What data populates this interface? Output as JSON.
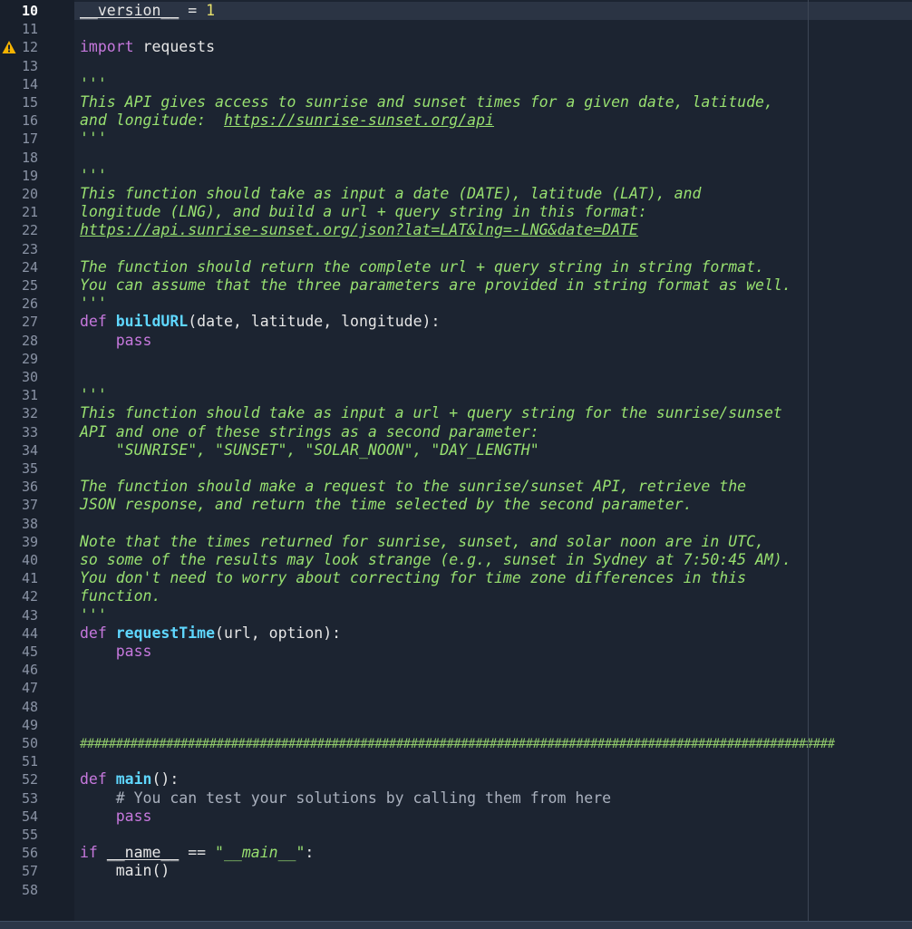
{
  "editor": {
    "current_line": "10",
    "warning_line": "12",
    "lines": [
      {
        "n": "10",
        "segs": [
          {
            "t": "__version__",
            "c": "dunder"
          },
          {
            "t": " = ",
            "c": ""
          },
          {
            "t": "1",
            "c": "num"
          }
        ]
      },
      {
        "n": "11",
        "segs": []
      },
      {
        "n": "12",
        "segs": [
          {
            "t": "import",
            "c": "kw"
          },
          {
            "t": " requests",
            "c": ""
          }
        ]
      },
      {
        "n": "13",
        "segs": []
      },
      {
        "n": "14",
        "segs": [
          {
            "t": "'''",
            "c": "doc"
          }
        ]
      },
      {
        "n": "15",
        "segs": [
          {
            "t": "This API gives access to sunrise and sunset times for a given date, latitude,",
            "c": "doc"
          }
        ]
      },
      {
        "n": "16",
        "segs": [
          {
            "t": "and longitude:  ",
            "c": "doc"
          },
          {
            "t": "https://sunrise-sunset.org/api",
            "c": "doc link"
          }
        ]
      },
      {
        "n": "17",
        "segs": [
          {
            "t": "'''",
            "c": "doc"
          }
        ]
      },
      {
        "n": "18",
        "segs": []
      },
      {
        "n": "19",
        "segs": [
          {
            "t": "'''",
            "c": "doc"
          }
        ]
      },
      {
        "n": "20",
        "segs": [
          {
            "t": "This function should take as input a date (DATE), latitude (LAT), and",
            "c": "doc"
          }
        ]
      },
      {
        "n": "21",
        "segs": [
          {
            "t": "longitude (LNG), and build a url + query string in this format:",
            "c": "doc"
          }
        ]
      },
      {
        "n": "22",
        "segs": [
          {
            "t": "https://api.sunrise-sunset.org/json?lat=LAT&lng=-LNG&date=DATE",
            "c": "doc link"
          }
        ]
      },
      {
        "n": "23",
        "segs": []
      },
      {
        "n": "24",
        "segs": [
          {
            "t": "The function should return the complete url + query string in string format.",
            "c": "doc"
          }
        ]
      },
      {
        "n": "25",
        "segs": [
          {
            "t": "You can assume that the three parameters are provided in string format as well.",
            "c": "doc"
          }
        ]
      },
      {
        "n": "26",
        "segs": [
          {
            "t": "'''",
            "c": "doc"
          }
        ]
      },
      {
        "n": "27",
        "segs": [
          {
            "t": "def",
            "c": "kw"
          },
          {
            "t": " ",
            "c": ""
          },
          {
            "t": "buildURL",
            "c": "fn"
          },
          {
            "t": "(date, latitude, longitude):",
            "c": ""
          }
        ]
      },
      {
        "n": "28",
        "segs": [
          {
            "t": "    ",
            "c": ""
          },
          {
            "t": "pass",
            "c": "kw"
          }
        ]
      },
      {
        "n": "29",
        "segs": []
      },
      {
        "n": "30",
        "segs": []
      },
      {
        "n": "31",
        "segs": [
          {
            "t": "'''",
            "c": "doc"
          }
        ]
      },
      {
        "n": "32",
        "segs": [
          {
            "t": "This function should take as input a url + query string for the sunrise/sunset",
            "c": "doc"
          }
        ]
      },
      {
        "n": "33",
        "segs": [
          {
            "t": "API and one of these strings as a second parameter:",
            "c": "doc"
          }
        ]
      },
      {
        "n": "34",
        "segs": [
          {
            "t": "    \"SUNRISE\", \"SUNSET\", \"SOLAR_NOON\", \"DAY_LENGTH\"",
            "c": "doc"
          }
        ]
      },
      {
        "n": "35",
        "segs": []
      },
      {
        "n": "36",
        "segs": [
          {
            "t": "The function should make a request to the sunrise/sunset API, retrieve the",
            "c": "doc"
          }
        ]
      },
      {
        "n": "37",
        "segs": [
          {
            "t": "JSON response, and return the time selected by the second parameter.",
            "c": "doc"
          }
        ]
      },
      {
        "n": "38",
        "segs": []
      },
      {
        "n": "39",
        "segs": [
          {
            "t": "Note that the times returned for sunrise, sunset, and solar noon are in UTC,",
            "c": "doc"
          }
        ]
      },
      {
        "n": "40",
        "segs": [
          {
            "t": "so some of the results may look strange (e.g., sunset in Sydney at 7:50:45 AM).",
            "c": "doc"
          }
        ]
      },
      {
        "n": "41",
        "segs": [
          {
            "t": "You don't need to worry about correcting for time zone differences in this",
            "c": "doc"
          }
        ]
      },
      {
        "n": "42",
        "segs": [
          {
            "t": "function.",
            "c": "doc"
          }
        ]
      },
      {
        "n": "43",
        "segs": [
          {
            "t": "'''",
            "c": "doc"
          }
        ]
      },
      {
        "n": "44",
        "segs": [
          {
            "t": "def",
            "c": "kw"
          },
          {
            "t": " ",
            "c": ""
          },
          {
            "t": "requestTime",
            "c": "fn"
          },
          {
            "t": "(url, option):",
            "c": ""
          }
        ]
      },
      {
        "n": "45",
        "segs": [
          {
            "t": "    ",
            "c": ""
          },
          {
            "t": "pass",
            "c": "kw"
          }
        ]
      },
      {
        "n": "46",
        "segs": []
      },
      {
        "n": "47",
        "segs": []
      },
      {
        "n": "48",
        "segs": []
      },
      {
        "n": "49",
        "segs": []
      },
      {
        "n": "50",
        "segs": [
          {
            "t": "#########################################################################################################",
            "c": "hashes"
          }
        ]
      },
      {
        "n": "51",
        "segs": []
      },
      {
        "n": "52",
        "segs": [
          {
            "t": "def",
            "c": "kw"
          },
          {
            "t": " ",
            "c": ""
          },
          {
            "t": "main",
            "c": "fn"
          },
          {
            "t": "():",
            "c": ""
          }
        ]
      },
      {
        "n": "53",
        "segs": [
          {
            "t": "    # You can test your solutions by calling them from here",
            "c": "cmt"
          }
        ]
      },
      {
        "n": "54",
        "segs": [
          {
            "t": "    ",
            "c": ""
          },
          {
            "t": "pass",
            "c": "kw"
          }
        ]
      },
      {
        "n": "55",
        "segs": []
      },
      {
        "n": "56",
        "segs": [
          {
            "t": "if",
            "c": "kw"
          },
          {
            "t": " ",
            "c": ""
          },
          {
            "t": "__name__",
            "c": "dunder"
          },
          {
            "t": " == ",
            "c": ""
          },
          {
            "t": "\"",
            "c": "str"
          },
          {
            "t": "__main__",
            "c": "strit"
          },
          {
            "t": "\"",
            "c": "str"
          },
          {
            "t": ":",
            "c": ""
          }
        ]
      },
      {
        "n": "57",
        "segs": [
          {
            "t": "    main()",
            "c": ""
          }
        ]
      },
      {
        "n": "58",
        "segs": []
      }
    ]
  }
}
